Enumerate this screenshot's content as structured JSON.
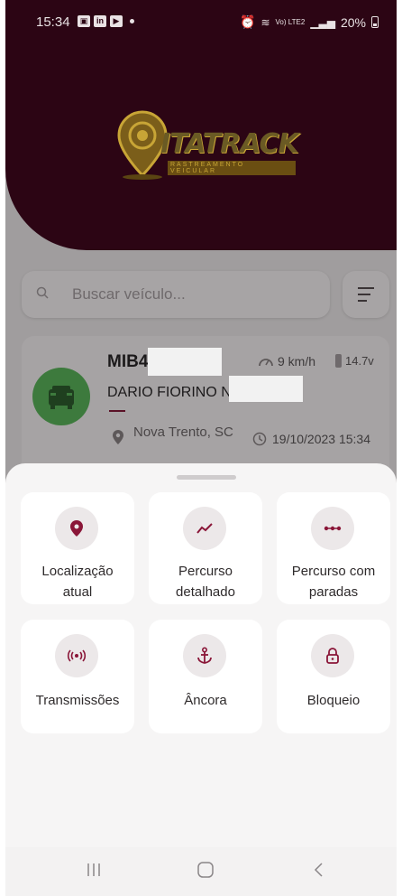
{
  "status_bar": {
    "time": "15:34",
    "notif_icons": [
      "image-icon",
      "linkedin-icon",
      "youtube-icon"
    ],
    "right_text": "Vo) LTE2",
    "battery": "20%"
  },
  "logo": {
    "name": "ITATRACK",
    "tagline": "RASTREAMENTO VEICULAR"
  },
  "search": {
    "placeholder": "Buscar veículo..."
  },
  "vehicle": {
    "plate": "MIB4",
    "driver": "DARIO FIORINO N",
    "speed": "9 km/h",
    "voltage": "14.7v",
    "city": "Nova Trento, SC",
    "datetime": "19/10/2023 15:34"
  },
  "actions": [
    {
      "label_line1": "Localização",
      "label_line2": "atual",
      "icon": "location-pin-icon"
    },
    {
      "label_line1": "Percurso",
      "label_line2": "detalhado",
      "icon": "route-line-icon"
    },
    {
      "label_line1": "Percurso com",
      "label_line2": "paradas",
      "icon": "stops-dots-icon"
    },
    {
      "label_line1": "Transmissões",
      "icon": "broadcast-icon"
    },
    {
      "label_line1": "Âncora",
      "icon": "anchor-icon"
    },
    {
      "label_line1": "Bloqueio",
      "icon": "lock-icon"
    }
  ],
  "colors": {
    "brand_maroon": "#2c0514",
    "accent": "#8a1638",
    "vehicle_online": "#3d7a3d"
  }
}
